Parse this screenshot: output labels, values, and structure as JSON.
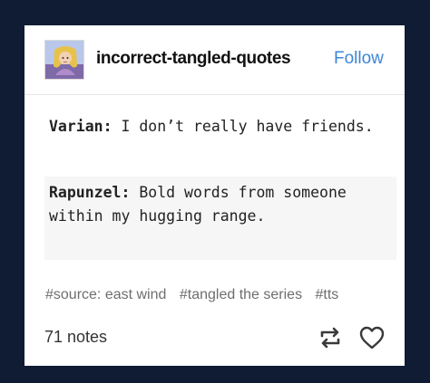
{
  "post": {
    "blog_name": "incorrect-tangled-quotes",
    "follow_label": "Follow",
    "lines": [
      {
        "speaker": "Varian:",
        "text": " I don’t really have friends."
      },
      {
        "speaker": "Rapunzel:",
        "text": " Bold words from someone within my hugging range."
      }
    ],
    "tags": [
      "#source: east wind",
      "#tangled the series",
      "#tts"
    ],
    "notes": "71 notes"
  },
  "icons": {
    "avatar": "rapunzel-avatar",
    "reblog": "reblog-icon",
    "like": "heart-icon"
  },
  "colors": {
    "background": "#0f1c33",
    "card": "#ffffff",
    "follow": "#3d86d8",
    "tag": "#6e6e6e"
  }
}
